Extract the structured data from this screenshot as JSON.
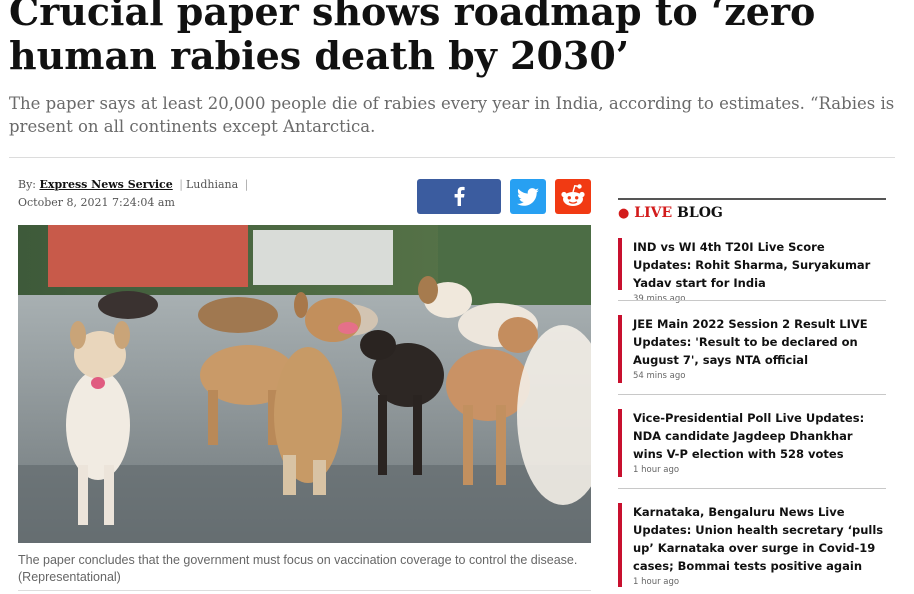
{
  "article": {
    "headline": "Crucial paper shows roadmap to ‘zero human rabies death by 2030’",
    "synopsis": "The paper says at least 20,000 people die of rabies every year in India, according to estimates. “Rabies is present on all continents except Antarctica.",
    "byline": {
      "prefix": "By:",
      "author": "Express News Service",
      "separator": "|",
      "location": "Ludhiana",
      "datetime": "October 8, 2021 7:24:04 am"
    },
    "share": {
      "icons": [
        "facebook-icon",
        "twitter-icon",
        "reddit-icon"
      ],
      "colors": {
        "facebook": "#3b5c9f",
        "twitter": "#27a0f2",
        "reddit": "#f13a13"
      }
    },
    "image_caption": "The paper concludes that the government must focus on vaccination coverage to control the disease. (Representational)"
  },
  "live_blog": {
    "label_live": "LIVE",
    "label_blog": "BLOG",
    "accent": "#c8102e",
    "items": [
      {
        "title": "IND vs WI 4th T20I Live Score Updates: Rohit Sharma, Suryakumar Yadav start for India",
        "time": "39 mins ago"
      },
      {
        "title": "JEE Main 2022 Session 2 Result LIVE Updates: 'Result to be declared on August 7', says NTA official",
        "time": "54 mins ago"
      },
      {
        "title": "Vice-Presidential Poll Live Updates: NDA candidate Jagdeep Dhankhar wins V-P election with 528 votes",
        "time": "1 hour ago"
      },
      {
        "title": "Karnataka, Bengaluru News Live Updates: Union health secretary ‘pulls up’ Karnataka over surge in Covid-19 cases; Bommai tests positive again",
        "time": "1 hour ago"
      }
    ]
  }
}
